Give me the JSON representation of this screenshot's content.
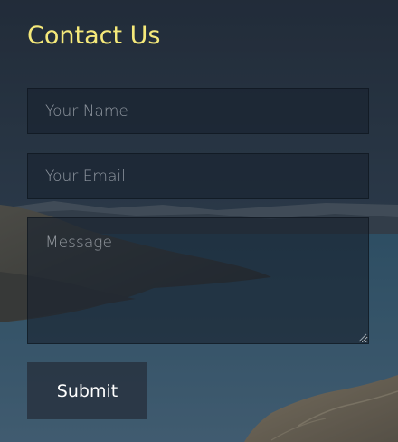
{
  "form": {
    "title": "Contact Us",
    "name_placeholder": "Your Name",
    "email_placeholder": "Your Email",
    "message_placeholder": "Message",
    "submit_label": "Submit"
  },
  "colors": {
    "title": "#f5e97a",
    "field_background": "#18222e",
    "button_background": "#26303c"
  }
}
